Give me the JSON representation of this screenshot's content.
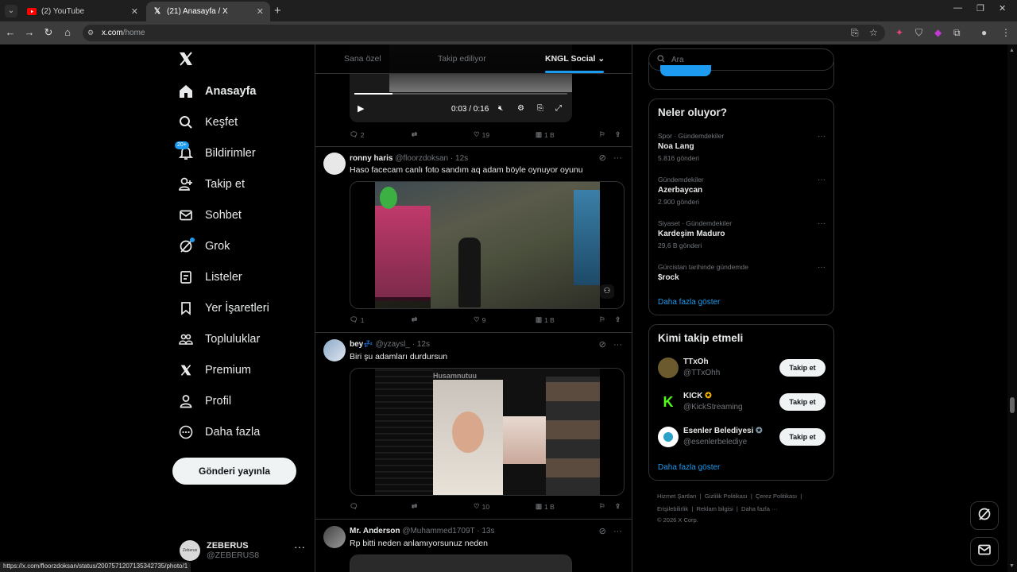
{
  "browser": {
    "tabs": [
      {
        "title": "(2) YouTube",
        "icon": "youtube-icon"
      },
      {
        "title": "(21) Anasayfa / X",
        "icon": "x-logo-icon"
      }
    ],
    "url_host": "x.com",
    "url_path": "/home",
    "status_url": "https://x.com/floorzdoksan/status/2007571207135342735/photo/1"
  },
  "nav": {
    "logo": "X",
    "items": [
      {
        "label": "Anasayfa",
        "icon": "home-icon"
      },
      {
        "label": "Keşfet",
        "icon": "search-icon"
      },
      {
        "label": "Bildirimler",
        "icon": "bell-icon",
        "badge": "20+"
      },
      {
        "label": "Takip et",
        "icon": "add-person-icon"
      },
      {
        "label": "Sohbet",
        "icon": "mail-icon"
      },
      {
        "label": "Grok",
        "icon": "grok-icon"
      },
      {
        "label": "Listeler",
        "icon": "list-icon"
      },
      {
        "label": "Yer İşaretleri",
        "icon": "bookmark-icon"
      },
      {
        "label": "Topluluklar",
        "icon": "communities-icon"
      },
      {
        "label": "Premium",
        "icon": "x-logo-icon"
      },
      {
        "label": "Profil",
        "icon": "person-icon"
      },
      {
        "label": "Daha fazla",
        "icon": "more-circle-icon"
      }
    ],
    "post_button": "Gönderi yayınla",
    "me": {
      "name": "ZEBERUS",
      "handle": "@ZEBERUS8",
      "avatar_text": "Zeberus"
    }
  },
  "feed": {
    "tabs": [
      "Sana özel",
      "Takip ediliyor",
      "KNGL Social"
    ],
    "active_tab": "KNGL Social",
    "video_time": "0:03 / 0:16",
    "first_stats": {
      "replies": "2",
      "likes": "19",
      "views": "1 B"
    },
    "tweets": [
      {
        "name": "ronny haris",
        "handle": "@floorzdoksan",
        "time": "12s",
        "text": "Haso facecam canlı foto sandım aq adam böyle oynuyor oyunu",
        "replies": "1",
        "retweets": "",
        "likes": "9",
        "views": "1 B"
      },
      {
        "name": "bey💤",
        "handle": "@yzaysl_",
        "time": "12s",
        "text": "Biri şu adamları durdursun",
        "replies": "",
        "retweets": "",
        "likes": "10",
        "views": "1 B",
        "overlay": "Husamnutuu"
      },
      {
        "name": "Mr. Anderson",
        "handle": "@Muhammed1709T",
        "time": "13s",
        "text": "Rp bitti neden anlamıyorsunuz neden"
      }
    ]
  },
  "right": {
    "search_placeholder": "Ara",
    "trends_title": "Neler oluyor?",
    "trends": [
      {
        "category": "Spor · Gündemdekiler",
        "name": "Noa Lang",
        "count": "5.816 gönderi"
      },
      {
        "category": "Gündemdekiler",
        "name": "Azerbaycan",
        "count": "2.900 gönderi"
      },
      {
        "category": "Siyaset · Gündemdekiler",
        "name": "Kardeşim Maduro",
        "count": "29,6 B gönderi"
      },
      {
        "category": "Gürcistan tarihinde gündemde",
        "name": "$rock",
        "count": ""
      }
    ],
    "show_more": "Daha fazla göster",
    "who_title": "Kimi takip etmeli",
    "who": [
      {
        "name": "TTxOh",
        "handle": "@TTxOhh",
        "verified": false,
        "avatar": "#6b5a2e",
        "button": "Takip et"
      },
      {
        "name": "KICK",
        "handle": "@KickStreaming",
        "verified": true,
        "badge_color": "#f4b400",
        "avatar": "#000000",
        "button": "Takip et"
      },
      {
        "name": "Esenler Belediyesi",
        "handle": "@esenlerbelediye",
        "verified": true,
        "badge_color": "#829aab",
        "avatar": "#ffffff",
        "button": "Takip et"
      }
    ],
    "footer": [
      "Hizmet Şartları",
      "|",
      "Gizlilik Politikası",
      "|",
      "Çerez Politikası",
      "|",
      "Erişilebilirlik",
      "|",
      "Reklam bilgisi",
      "|",
      "Daha fazla ···",
      "© 2026 X Corp."
    ]
  },
  "colors": {
    "accent": "#1d9bf0",
    "bg": "#000000",
    "border": "#2f3336",
    "muted": "#71767b"
  }
}
